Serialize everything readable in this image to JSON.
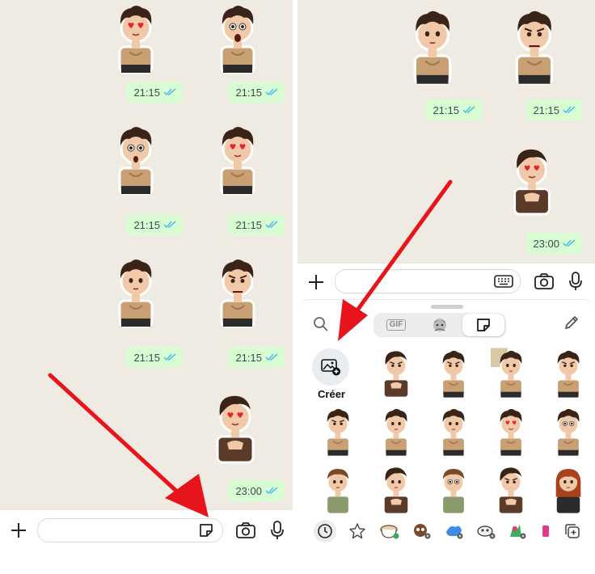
{
  "left": {
    "timestamps": [
      "21:15",
      "21:15",
      "21:15",
      "21:15",
      "21:15",
      "21:15",
      "23:00"
    ]
  },
  "right": {
    "timestamps": [
      "21:15",
      "21:15",
      "23:00"
    ],
    "tabs": {
      "gif_label": "GIF"
    },
    "create_label": "Créer"
  },
  "colors": {
    "chat_background": "#efeae2",
    "sent_bubble": "#d9fdd3",
    "read_ticks": "#53bdeb",
    "annotation_arrow": "#e8141b",
    "sticker_shirt_tan": "#c9a074",
    "sticker_shirt_brown": "#5a3a28",
    "sticker_hair": "#3a2418"
  },
  "icons": {
    "input_bar": [
      "plus-icon",
      "sticker-icon",
      "camera-icon",
      "microphone-icon",
      "keyboard-icon"
    ],
    "tray": [
      "search-icon",
      "gif-icon",
      "avatar-icon",
      "sticker-icon",
      "pencil-icon",
      "add-image-icon"
    ],
    "categories": [
      "recent-icon",
      "favorites-star-icon",
      "coffee-pack-icon",
      "pack-2-icon",
      "pack-3-icon",
      "pack-4-icon",
      "pack-5-icon",
      "pack-6-icon",
      "add-pack-icon"
    ]
  }
}
